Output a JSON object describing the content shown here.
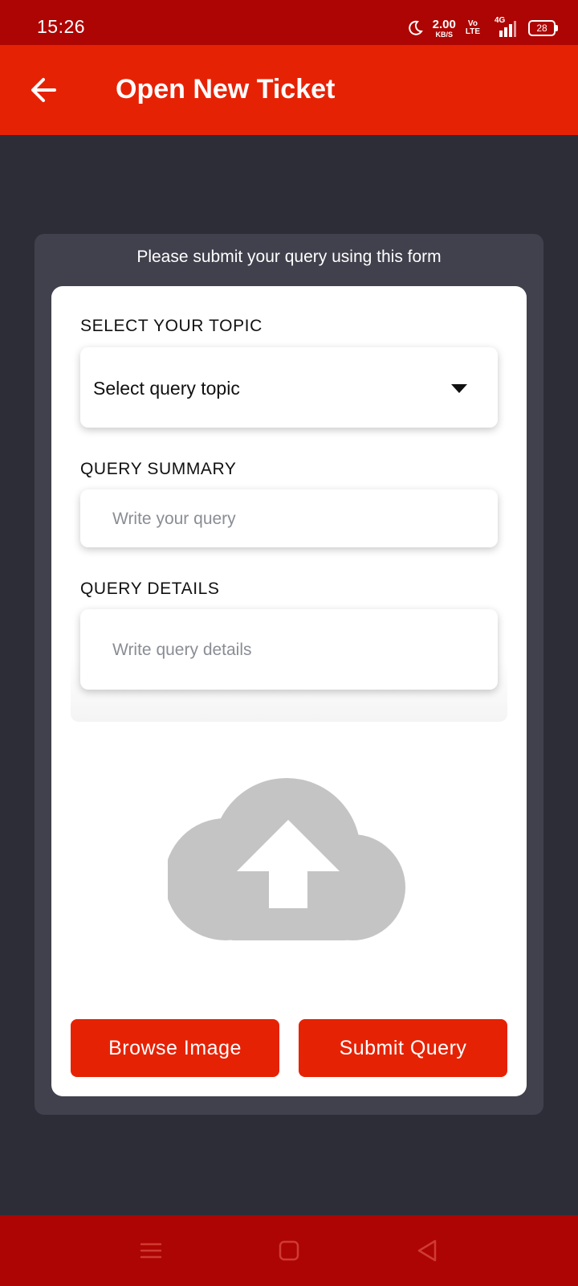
{
  "status_bar": {
    "time": "15:26",
    "net_speed_value": "2.00",
    "net_speed_unit": "KB/S",
    "volte_top": "Vo",
    "volte_bottom": "LTE",
    "network_type": "4G",
    "battery_level": "28",
    "icons": [
      "moon-icon",
      "signal-icon",
      "battery-icon"
    ]
  },
  "app_bar": {
    "back_icon": "arrow-left-icon",
    "title": "Open New Ticket"
  },
  "form": {
    "caption": "Please submit your query using this form",
    "topic": {
      "label": "SELECT YOUR TOPIC",
      "selected": "Select query topic",
      "icon": "caret-down-icon"
    },
    "summary": {
      "label": "QUERY SUMMARY",
      "placeholder": "Write your query",
      "value": ""
    },
    "details": {
      "label": "QUERY DETAILS",
      "placeholder": "Write query details",
      "value": ""
    },
    "upload_icon": "cloud-upload-icon",
    "browse_label": "Browse Image",
    "submit_label": "Submit Query"
  },
  "nav_bar": {
    "items": [
      "menu-icon",
      "home-square-icon",
      "back-triangle-icon"
    ]
  },
  "colors": {
    "status_bar": "#ad0503",
    "accent": "#e62205",
    "background": "#2c2d37",
    "card": "#40414c",
    "upload_icon": "#c4c4c4"
  }
}
